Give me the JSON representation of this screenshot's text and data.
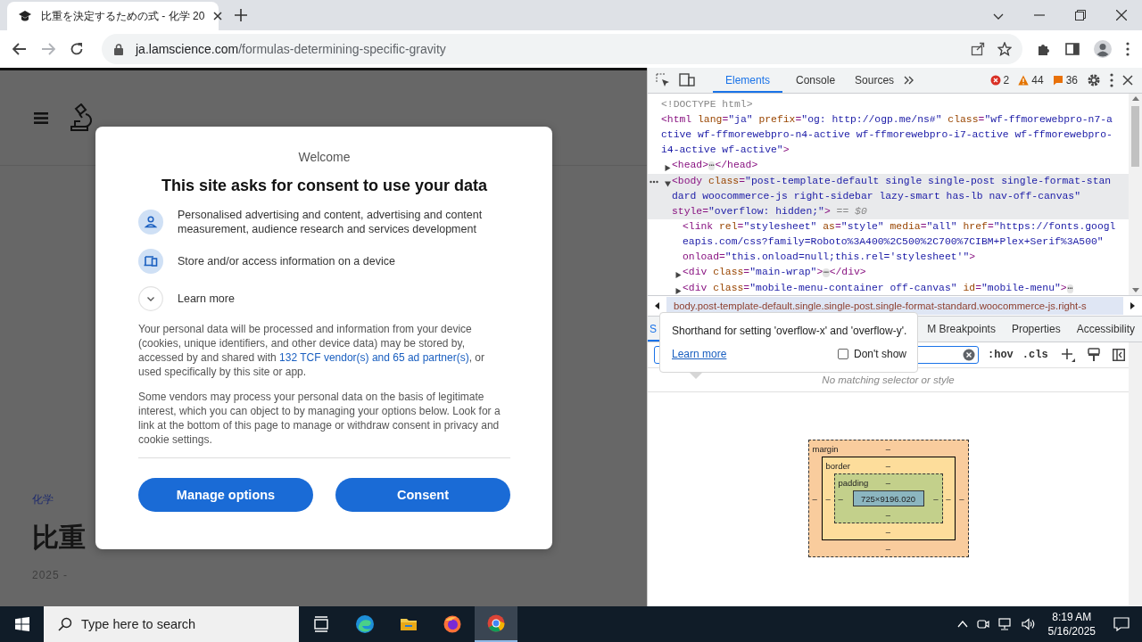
{
  "browser": {
    "tab": {
      "title": "比重を決定するための式 - 化学 20",
      "selected": true
    },
    "address": {
      "host": "ja.lamscience.com",
      "path": "/formulas-determining-specific-gravity"
    },
    "forward_disabled": true
  },
  "page": {
    "category": "化学",
    "heading": "比重",
    "date": "2025 -"
  },
  "consent": {
    "eyebrow": "Welcome",
    "title": "This site asks for consent to use your data",
    "purposes": [
      {
        "kind": "person",
        "text": "Personalised advertising and content, advertising and content measurement, audience research and services development"
      },
      {
        "kind": "device",
        "text": "Store and/or access information on a device"
      }
    ],
    "learn_more": {
      "label": "Learn more",
      "expanded": false
    },
    "paragraphs": [
      [
        {
          "text": "Your personal data will be processed and information from your device (cookies, unique identifiers, and other device data) may be stored by, accessed by and shared with "
        },
        {
          "text": "132 TCF vendor(s) and 65 ad partner(s)",
          "link": true
        },
        {
          "text": ", or used specifically by this site or app."
        }
      ],
      [
        {
          "text": "Some vendors may process your personal data on the basis of legitimate interest, which you can object to by managing your options below. Look for a link at the bottom of this page to manage or withdraw consent in privacy and cookie settings."
        }
      ]
    ],
    "buttons": [
      "Manage options",
      "Consent"
    ]
  },
  "devtools": {
    "tabs": [
      {
        "label": "Elements",
        "selected": true
      },
      {
        "label": "Console",
        "selected": false
      },
      {
        "label": "Sources",
        "selected": false
      }
    ],
    "errors": "2",
    "warnings": "44",
    "infos": "36",
    "dom": [
      {
        "kind": "doctype",
        "selected": false,
        "lines": [
          "<!DOCTYPE html>"
        ]
      },
      {
        "kind": "element",
        "selected": false,
        "lines": [
          "<html lang=\"ja\" prefix=\"og: http://ogp.me/ns#\" class=\"wf-ffmorewebpro-n7-a",
          "ctive wf-ffmorewebpro-n4-active wf-ffmorewebpro-i7-active wf-ffmorewebpro-",
          "i4-active wf-active\">"
        ],
        "children": [
          {
            "kind": "element",
            "selected": false,
            "expanded": false,
            "lines": [
              "<head>⋯</head>"
            ]
          },
          {
            "kind": "element",
            "selected": true,
            "expanded": true,
            "marker": "== $0",
            "lines": [
              "<body class=\"post-template-default single single-post single-format-stan",
              "dard woocommerce-js right-sidebar lazy-smart has-lb nav-off-canvas\"",
              "style=\"overflow: hidden;\">"
            ],
            "children": [
              {
                "kind": "element",
                "selected": false,
                "lines": [
                  "<link rel=\"stylesheet\" as=\"style\" media=\"all\" href=\"https://fonts.googl",
                  "eapis.com/css?family=Roboto%3A400%2C500%2C700%7CIBM+Plex+Serif%3A500\"",
                  "onload=\"this.onload=null;this.rel='stylesheet'\">"
                ]
              },
              {
                "kind": "element",
                "selected": false,
                "expanded": false,
                "lines": [
                  "<div class=\"main-wrap\">⋯</div>"
                ]
              },
              {
                "kind": "element",
                "selected": false,
                "expanded": false,
                "lines": [
                  "<div class=\"mobile-menu-container off-canvas\" id=\"mobile-menu\">⋯"
                ]
              }
            ]
          }
        ]
      }
    ],
    "breadcrumb": "body.post-template-default.single.single-post.single-format-standard.woocommerce-js.right-s",
    "subtabs": [
      {
        "label": "S",
        "selected": true
      },
      {
        "label": "M Breakpoints",
        "selected": false
      },
      {
        "label": "Properties",
        "selected": false
      },
      {
        "label": "Accessibility",
        "selected": false
      }
    ],
    "hov": ":hov",
    "cls": ".cls",
    "empty": "No matching selector or style",
    "box_model": {
      "margin": {
        "label": "margin",
        "top": "–",
        "right": "–",
        "bottom": "–",
        "left": "–"
      },
      "border": {
        "label": "border",
        "top": "–",
        "right": "–",
        "bottom": "–",
        "left": "–"
      },
      "padding": {
        "label": "padding",
        "top": "–",
        "right": "–",
        "bottom": "–",
        "left": "–"
      },
      "content": "725×9196.020"
    },
    "tooltip": {
      "text": "Shorthand for setting 'overflow-x' and 'overflow-y'.",
      "link": "Learn more",
      "checkbox": {
        "label": "Don't show",
        "checked": false
      }
    }
  },
  "taskbar": {
    "search": {
      "placeholder": "Type here to search"
    },
    "apps": [
      {
        "kind": "taskview",
        "selected": false
      },
      {
        "kind": "edge",
        "selected": false
      },
      {
        "kind": "files",
        "selected": false
      },
      {
        "kind": "firefox",
        "selected": false
      },
      {
        "kind": "chrome",
        "selected": true
      }
    ],
    "time": "8:19 AM",
    "date": "5/16/2025"
  }
}
